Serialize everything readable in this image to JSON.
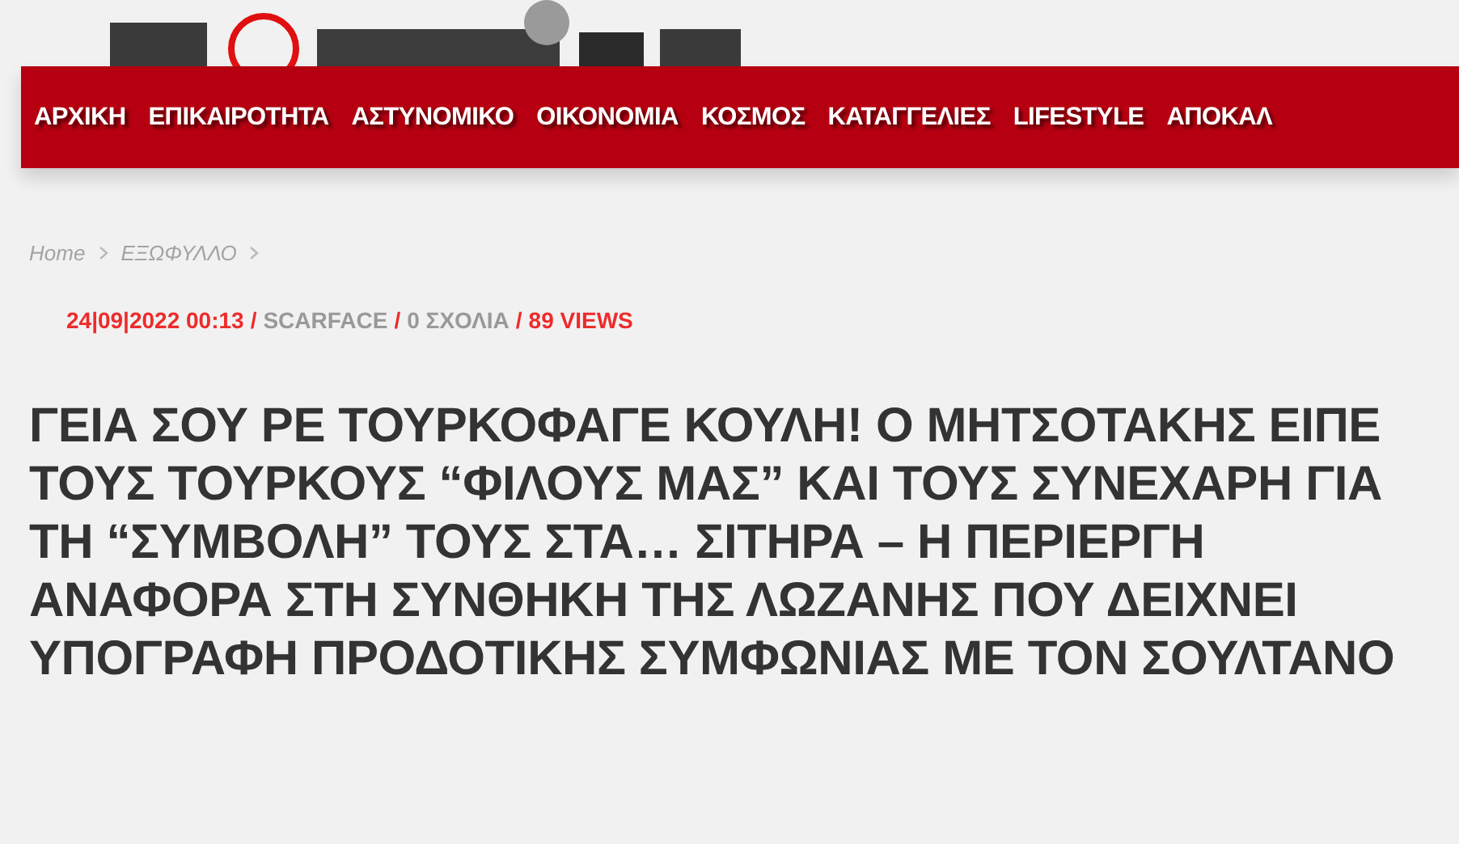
{
  "nav": {
    "items": [
      {
        "label": "ΑΡΧΙΚΗ"
      },
      {
        "label": "ΕΠΙΚΑΙΡΟΤΗΤΑ"
      },
      {
        "label": "ΑΣΤΥΝΟΜΙΚΟ"
      },
      {
        "label": "ΟΙΚΟΝΟΜΙΑ"
      },
      {
        "label": "ΚΟΣΜΟΣ"
      },
      {
        "label": "ΚΑΤΑΓΓΕΛΙΕΣ"
      },
      {
        "label": "LIFESTYLE"
      },
      {
        "label": "ΑΠΟΚΑΛ"
      }
    ]
  },
  "breadcrumb": [
    {
      "label": "Home"
    },
    {
      "label": "ΕΞΩΦΥΛΛΟ"
    }
  ],
  "meta": [
    {
      "kind": "date",
      "text": "24|09|2022 00:13"
    },
    {
      "kind": "separator",
      "text": "/"
    },
    {
      "kind": "author",
      "text": "SCARFACE"
    },
    {
      "kind": "separator",
      "text": "/"
    },
    {
      "kind": "comments",
      "text": "0 ΣΧΟΛΙΑ"
    },
    {
      "kind": "separator",
      "text": "/"
    },
    {
      "kind": "views",
      "text": "89 VIEWS"
    }
  ],
  "article": {
    "title": "ΓΕΙΑ ΣΟΥ ΡΕ ΤΟΥΡΚΟΦΑΓΕ ΚΟΥΛΗ! Ο ΜΗΤΣΟΤΑΚΗΣ ΕΙΠΕ ΤΟΥΣ ΤΟΥΡΚΟΥΣ “ΦΙΛΟΥΣ ΜΑΣ” ΚΑΙ ΤΟΥΣ ΣΥΝΕΧΑΡΗ ΓΙΑ ΤΗ “ΣΥΜΒΟΛΗ” ΤΟΥΣ ΣΤΑ… ΣΙΤΗΡΑ – Η ΠΕΡΙΕΡΓΗ ΑΝΑΦΟΡΑ ΣΤΗ ΣΥΝΘΗΚΗ ΤΗΣ ΛΩΖΑΝΗΣ ΠΟΥ ΔΕΙΧΝΕΙ ΥΠΟΓΡΑΦΗ ΠΡΟΔΟΤΙΚΗΣ ΣΥΜΦΩΝΙΑΣ ΜΕ ΤΟΝ ΣΟΥΛΤΑΝΟ"
  }
}
